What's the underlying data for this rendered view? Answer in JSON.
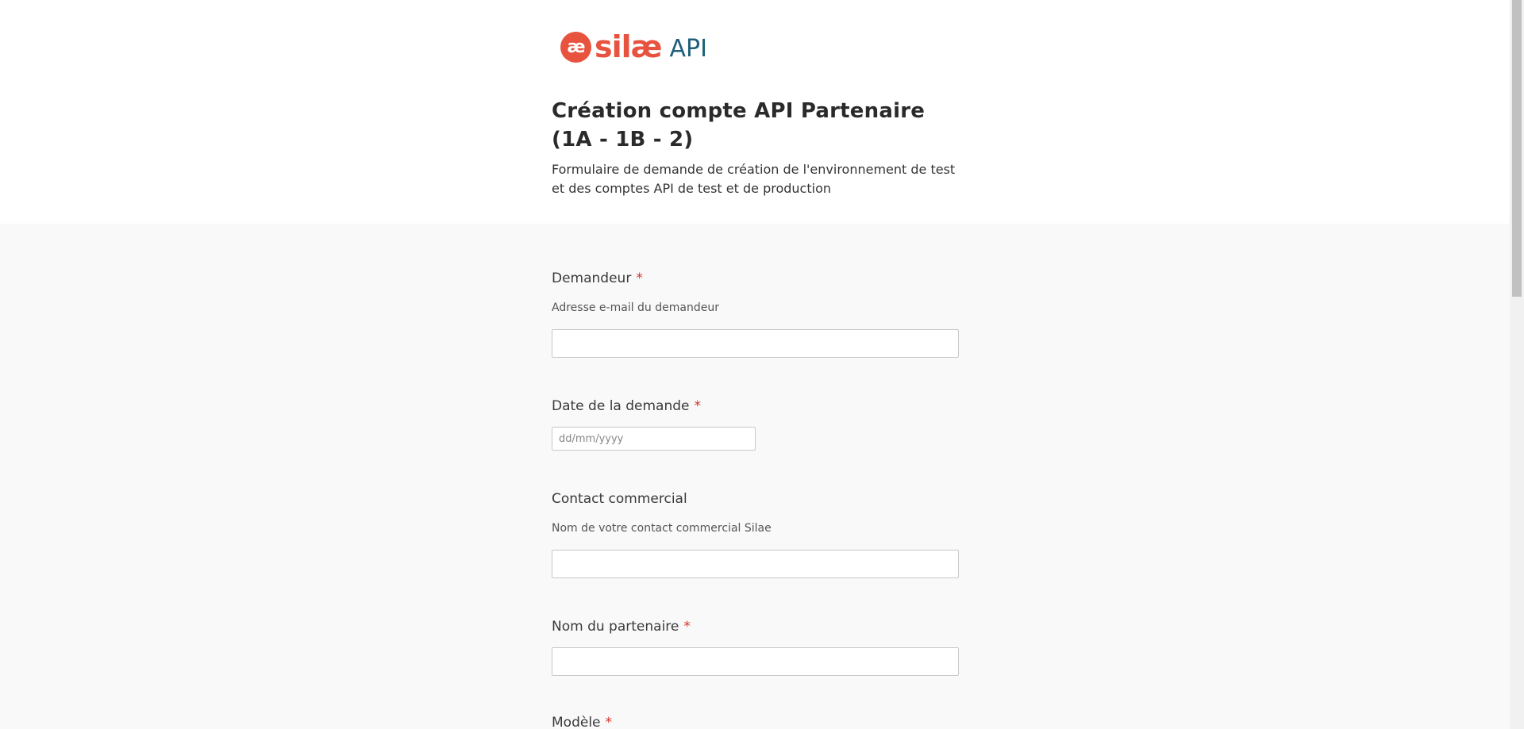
{
  "brand": {
    "badge": "æ",
    "name": "silæ",
    "product": "API",
    "colors": {
      "primary": "#e8533f",
      "secondary": "#1f5f7a"
    }
  },
  "form": {
    "title": "Création compte API Partenaire (1A - 1B - 2)",
    "subtitle": "Formulaire de demande de création de l'environnement de test et des comptes API de test et de production",
    "fields": [
      {
        "label": "Demandeur",
        "required_mark": "*",
        "hint": "Adresse e-mail du demandeur",
        "value": ""
      },
      {
        "label": "Date de la demande",
        "required_mark": "*",
        "placeholder": "dd/mm/yyyy",
        "value": ""
      },
      {
        "label": "Contact commercial",
        "hint": "Nom de votre contact commercial Silae",
        "value": ""
      },
      {
        "label": "Nom du partenaire",
        "required_mark": "*",
        "value": ""
      },
      {
        "label": "Modèle",
        "required_mark": "*"
      }
    ]
  }
}
